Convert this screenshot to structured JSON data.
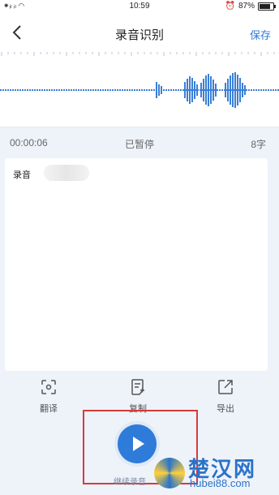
{
  "status": {
    "carrier": "ᵀₐᴵₗᵀₐᴵ",
    "time": "10:59",
    "battery": "87%"
  },
  "nav": {
    "title": "录音识别",
    "save": "保存"
  },
  "recording": {
    "duration": "00:00:06",
    "state": "已暂停",
    "count": "8字"
  },
  "card": {
    "text": "录音"
  },
  "actions": [
    {
      "label": "翻译",
      "icon": "translate-icon"
    },
    {
      "label": "复制",
      "icon": "copy-icon"
    },
    {
      "label": "导出",
      "icon": "export-icon"
    }
  ],
  "playback": {
    "continue": "继续录音"
  },
  "watermark": {
    "title": "楚汉网",
    "sub": "hubei88.com"
  },
  "colors": {
    "accent": "#2f7bd9",
    "highlight": "#d63b3b"
  }
}
